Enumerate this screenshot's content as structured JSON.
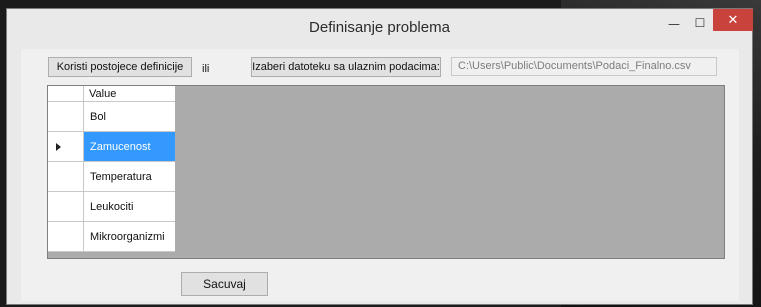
{
  "window": {
    "title": "Definisanje problema",
    "minimize_glyph": "—",
    "maximize_glyph": "☐",
    "close_glyph": "✕"
  },
  "toolbar": {
    "use_existing_label": "Koristi postojece definicije",
    "or_label": "ili",
    "choose_file_label": "Izaberi datoteku sa ulaznim podacima:",
    "file_path_value": "C:\\Users\\Public\\Documents\\Podaci_Finalno.csv"
  },
  "grid": {
    "column_header": "Value",
    "rows": [
      {
        "value": "Bol",
        "selected": false
      },
      {
        "value": "Zamucenost",
        "selected": true
      },
      {
        "value": "Temperatura",
        "selected": false
      },
      {
        "value": "Leukociti",
        "selected": false
      },
      {
        "value": "Mikroorganizmi",
        "selected": false
      }
    ]
  },
  "footer": {
    "save_label": "Sacuvaj"
  },
  "colors": {
    "selection": "#3399ff",
    "close_button": "#c9423b",
    "grid_background": "#ababab"
  }
}
